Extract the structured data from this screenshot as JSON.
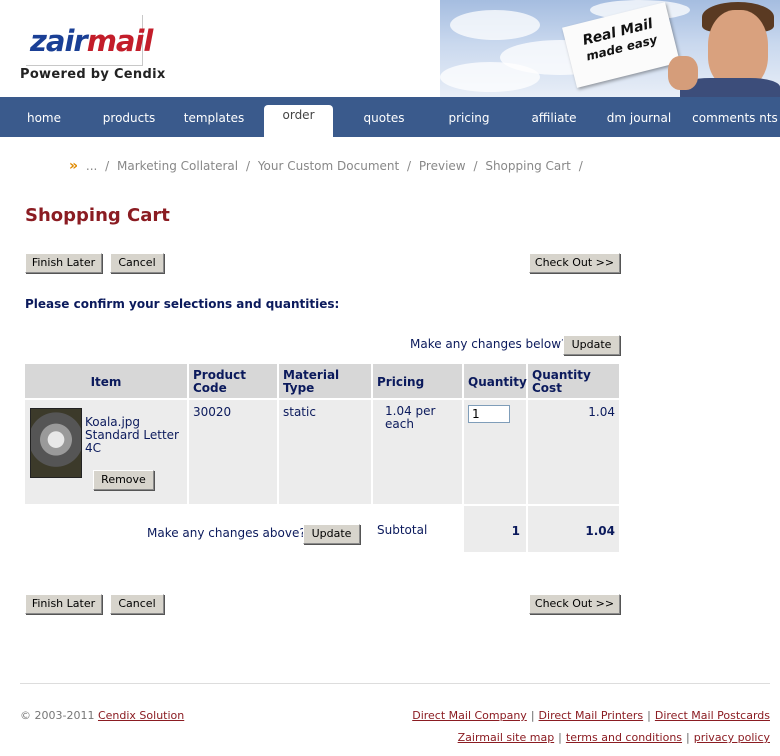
{
  "header": {
    "logo_part1": "zair",
    "logo_part2": "mail",
    "powered_by": "Powered by Cendix",
    "banner_line1": "Real Mail",
    "banner_line2": "made easy"
  },
  "nav": {
    "items": [
      "home",
      "products",
      "templates",
      "order",
      "quotes",
      "pricing",
      "affiliate",
      "dm journal",
      "comments nts"
    ],
    "active_index": 3
  },
  "breadcrumb": {
    "arrow": "»",
    "items": [
      "...",
      "Marketing Collateral",
      "Your Custom Document",
      "Preview",
      "Shopping Cart"
    ],
    "separator": "/"
  },
  "page_title": "Shopping Cart",
  "buttons": {
    "finish_later": "Finish Later",
    "cancel": "Cancel",
    "check_out": "Check Out >>",
    "update": "Update",
    "remove": "Remove"
  },
  "confirm_text": "Please confirm your selections and quantities:",
  "changes_below": "Make any changes below?",
  "changes_above": "Make any changes above?",
  "table": {
    "headers": [
      "Item",
      "Product Code",
      "Material Type",
      "Pricing",
      "Quantity",
      "Quantity Cost"
    ],
    "row": {
      "item_name": "Koala.jpg",
      "item_desc": "Standard Letter",
      "item_size": "4C",
      "product_code": "30020",
      "material_type": "static",
      "pricing": "1.04 per each",
      "quantity": "1",
      "quantity_cost": "1.04"
    },
    "subtotal_label": "Subtotal",
    "subtotal_qty": "1",
    "subtotal_cost": "1.04"
  },
  "footer": {
    "copyright": "© 2003-2011",
    "company_link": "Cendix Solution",
    "links_row1": [
      "Direct Mail Company",
      "Direct Mail Printers",
      "Direct Mail Postcards"
    ],
    "links_row2": [
      "Zairmail site map",
      "terms and conditions",
      "privacy policy"
    ]
  },
  "colors": {
    "nav_bg": "#3a5a8c",
    "title": "#8b1c22",
    "text_navy": "#0b1a5c",
    "table_header": "#d7d7d7",
    "table_body": "#ececec"
  }
}
